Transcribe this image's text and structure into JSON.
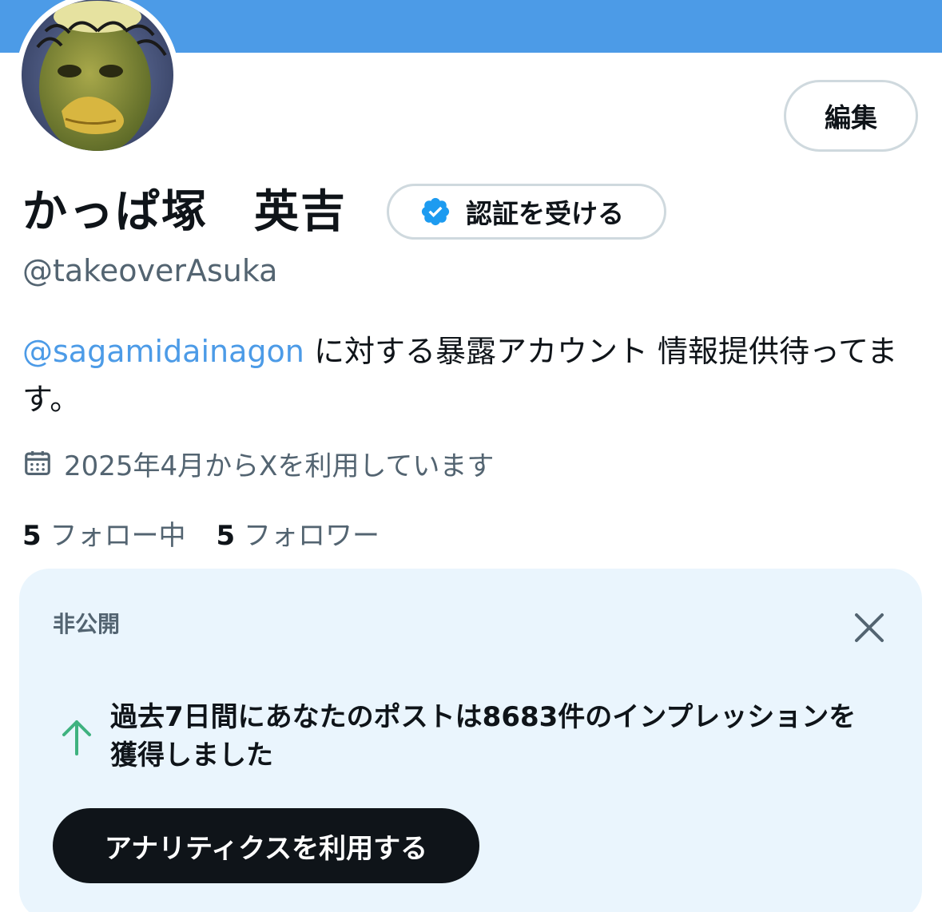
{
  "profile": {
    "name": "かっぱ塚　英吉",
    "handle": "@takeoverAsuka",
    "edit_label": "編集",
    "verify_label": "認証を受ける",
    "bio_mention": "@sagamidainagon",
    "bio_text": " に対する暴露アカウント 情報提供待ってます。",
    "joined": "2025年4月からXを利用しています",
    "following_count": "5",
    "following_label": "フォロー中",
    "followers_count": "5",
    "followers_label": "フォロワー"
  },
  "card": {
    "label": "非公開",
    "message": "過去7日間にあなたのポストは8683件のインプレッションを獲得しました",
    "button_label": "アナリティクスを利用する"
  },
  "colors": {
    "banner": "#4c9be7",
    "accent": "#1d9bf0",
    "card_bg": "#eaf5fd",
    "arrow": "#3fb27f"
  },
  "icons": {
    "verified": "verified-badge-icon",
    "calendar": "calendar-icon",
    "close": "close-icon",
    "arrow": "arrow-up-icon"
  }
}
